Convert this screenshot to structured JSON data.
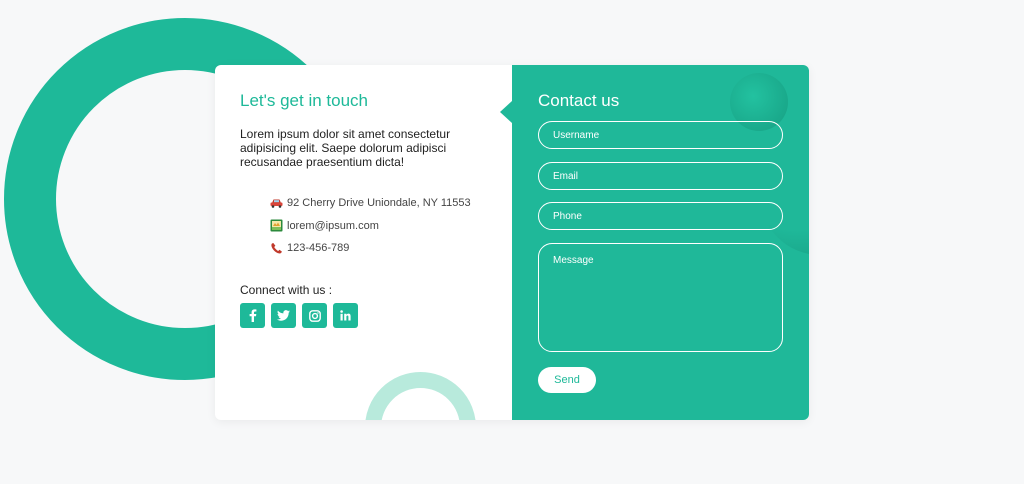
{
  "left": {
    "title": "Let's get in touch",
    "intro": "Lorem ipsum dolor sit amet consectetur adipisicing elit. Saepe dolorum adipisci recusandae praesentium dicta!",
    "info": [
      {
        "icon": "car-icon",
        "text": "92 Cherry Drive Uniondale, NY 11553"
      },
      {
        "icon": "mail-icon",
        "text": "lorem@ipsum.com"
      },
      {
        "icon": "phone-icon",
        "text": "123-456-789"
      }
    ],
    "connect_label": "Connect with us :",
    "socials": [
      {
        "name": "facebook",
        "glyph": "f"
      },
      {
        "name": "twitter",
        "glyph": "t"
      },
      {
        "name": "instagram",
        "glyph": "◎"
      },
      {
        "name": "linkedin",
        "glyph": "in"
      }
    ]
  },
  "form": {
    "title": "Contact us",
    "username_placeholder": "Username",
    "email_placeholder": "Email",
    "phone_placeholder": "Phone",
    "message_placeholder": "Message",
    "send_label": "Send"
  },
  "colors": {
    "accent": "#1eb999",
    "light_ring": "#b8eadc",
    "background": "#f7f8f9"
  }
}
